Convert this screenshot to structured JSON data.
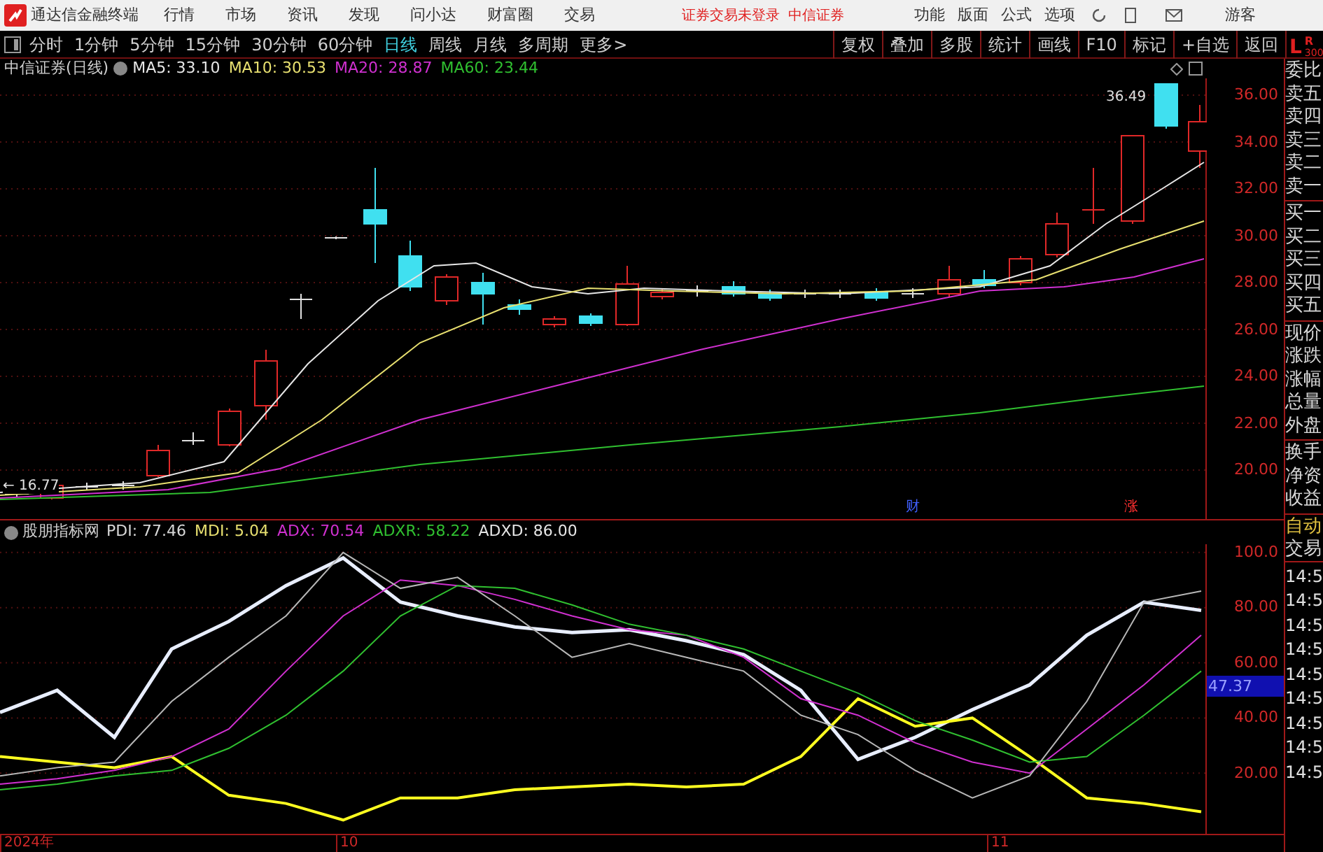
{
  "menu_bar": {
    "app_title": "通达信金融终端",
    "menus": [
      "行情",
      "市场",
      "资讯",
      "发现",
      "问小达",
      "财富圈",
      "交易"
    ],
    "notices": [
      "证券交易未登录",
      "中信证券"
    ],
    "right_menus": [
      "功能",
      "版面",
      "公式",
      "选项"
    ],
    "user": "游客"
  },
  "toolbar": {
    "periods": [
      {
        "label": "分时",
        "selected": false
      },
      {
        "label": "1分钟",
        "selected": false
      },
      {
        "label": "5分钟",
        "selected": false
      },
      {
        "label": "15分钟",
        "selected": false
      },
      {
        "label": "30分钟",
        "selected": false
      },
      {
        "label": "60分钟",
        "selected": false
      },
      {
        "label": "日线",
        "selected": true
      },
      {
        "label": "周线",
        "selected": false
      },
      {
        "label": "月线",
        "selected": false
      },
      {
        "label": "多周期",
        "selected": false
      },
      {
        "label": "更多>",
        "selected": false
      }
    ],
    "buttons": [
      "复权",
      "叠加",
      "多股",
      "统计",
      "画线",
      "F10",
      "标记",
      "+自选",
      "返回"
    ],
    "corner": {
      "left": "L",
      "right": "R",
      "count": "300"
    }
  },
  "main_chart": {
    "title": "中信证券(日线)",
    "ma_legend": [
      {
        "text": "MA5: 33.10",
        "color": "#e6e6e6"
      },
      {
        "text": "MA10: 30.53",
        "color": "#e8e070"
      },
      {
        "text": "MA20: 28.87",
        "color": "#d030d0"
      },
      {
        "text": "MA60: 23.44",
        "color": "#30c030"
      }
    ],
    "price_axis": [
      "36.00",
      "34.00",
      "32.00",
      "30.00",
      "28.00",
      "26.00",
      "24.00",
      "22.00",
      "20.00"
    ],
    "high_label": "36.49",
    "low_label": "← 16.77",
    "markers": [
      {
        "text": "财",
        "color": "#4060ff"
      },
      {
        "text": "涨",
        "color": "#ff3030"
      }
    ]
  },
  "date_axis": [
    "2024年",
    "10",
    "11"
  ],
  "indicator": {
    "name": "股朋指标网",
    "legend": [
      {
        "text": "PDI: 77.46",
        "color": "#d8d8d8"
      },
      {
        "text": "MDI: 5.04",
        "color": "#e8e070"
      },
      {
        "text": "ADX: 70.54",
        "color": "#d030d0"
      },
      {
        "text": "ADXR: 58.22",
        "color": "#30c030"
      },
      {
        "text": "ADXD: 86.00",
        "color": "#e6e6e6"
      }
    ],
    "cursor_value": "47.37",
    "chart_data": {
      "type": "line",
      "grid": true,
      "ylim": [
        -2,
        103
      ],
      "yticks": [
        {
          "value": 100,
          "label": "100.0"
        },
        {
          "value": 80,
          "label": "80.00"
        },
        {
          "value": 60,
          "label": "60.00"
        },
        {
          "value": 40,
          "label": "40.00"
        },
        {
          "value": 20,
          "label": "20.00"
        }
      ],
      "series": [
        {
          "color": "#e8eeff",
          "values": [
            42,
            50,
            33,
            65,
            75,
            88,
            98,
            82,
            77,
            73,
            71,
            72,
            68,
            63,
            50,
            25,
            33,
            43,
            52,
            70,
            82,
            79
          ]
        },
        {
          "color": "#ffff20",
          "values": [
            26,
            24,
            22,
            26,
            12,
            9,
            3,
            11,
            11,
            14,
            15,
            16,
            15,
            16,
            26,
            47,
            37,
            40,
            26,
            11,
            9,
            6
          ]
        },
        {
          "color": "#d030d0",
          "values": [
            16,
            18,
            21,
            26,
            36,
            57,
            77,
            90,
            88,
            83,
            77,
            72,
            70,
            62,
            47,
            41,
            31,
            24,
            20,
            36,
            52,
            70
          ]
        },
        {
          "color": "#30c030",
          "values": [
            14,
            16,
            19,
            21,
            29,
            41,
            57,
            77,
            88,
            87,
            81,
            74,
            70,
            65,
            57,
            49,
            39,
            32,
            24,
            26,
            41,
            57
          ]
        },
        {
          "color": "#b8b8b8",
          "values": [
            19,
            22,
            24,
            46,
            62,
            77,
            100,
            87,
            91,
            77,
            62,
            67,
            62,
            57,
            41,
            34,
            21,
            11,
            19,
            46,
            82,
            86
          ]
        }
      ]
    }
  },
  "side_panel": {
    "top_items": [
      "委比",
      "卖五",
      "卖四",
      "卖三",
      "卖二",
      "卖一",
      "买一",
      "买二",
      "买三",
      "买四",
      "买五"
    ],
    "quote_items": [
      "现价",
      "涨跌",
      "涨幅",
      "总量",
      "外盘"
    ],
    "extra_items": [
      "换手",
      "净资",
      "收益"
    ],
    "auto_label": "自动",
    "trade_label": "交易",
    "times": [
      "14:5",
      "14:5",
      "14:5",
      "14:5",
      "14:5",
      "14:5",
      "14:5",
      "14:5",
      "14:5"
    ]
  }
}
